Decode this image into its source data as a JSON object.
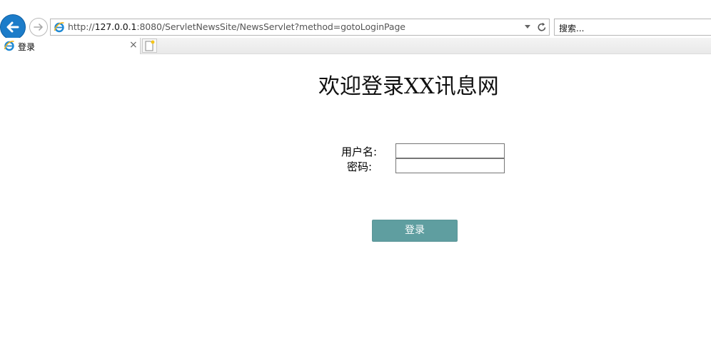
{
  "browser": {
    "address": {
      "protocol": "http://",
      "host": "127.0.0.1",
      "path": ":8080/ServletNewsSite/NewsServlet?method=gotoLoginPage"
    },
    "search_placeholder": "搜索...",
    "tab_title": "登录",
    "tab_close": "×",
    "icons": {
      "back": "back-arrow-icon",
      "forward": "forward-arrow-icon",
      "page": "ie-logo-icon",
      "dropdown": "chevron-down-icon",
      "refresh": "refresh-icon",
      "new_tab": "new-tab-icon"
    },
    "accent_color": "#1c7cc9"
  },
  "page": {
    "heading": "欢迎登录XX讯息网",
    "form": {
      "username_label": "用户名:",
      "password_label": "密码:",
      "username_value": "",
      "password_value": "",
      "submit_label": "登录"
    },
    "button_color": "#5f9ea0"
  }
}
